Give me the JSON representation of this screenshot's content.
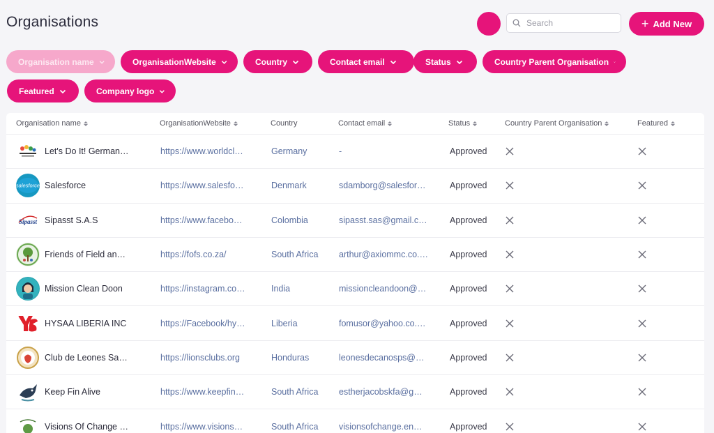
{
  "header": {
    "title": "Organisations",
    "search_placeholder": "Search",
    "add_label": "Add New"
  },
  "filters": [
    {
      "label": "Organisation name",
      "active": false
    },
    {
      "label": "OrganisationWebsite",
      "active": true
    },
    {
      "label": "Country",
      "active": true
    },
    {
      "label": "Contact email",
      "active": true
    },
    {
      "label": "Status",
      "active": true
    },
    {
      "label": "Country Parent Organisation",
      "active": true
    },
    {
      "label": "Featured",
      "active": true
    },
    {
      "label": "Company logo",
      "active": true
    }
  ],
  "columns": [
    "Organisation name",
    "OrganisationWebsite",
    "Country",
    "Contact email",
    "Status",
    "Country Parent Organisation",
    "Featured"
  ],
  "rows": [
    {
      "name": "Let's Do It! German…",
      "website": "https://www.worldcl…",
      "country": "Germany",
      "email": "-",
      "status": "Approved",
      "logo": "letsdoit-germany-logo"
    },
    {
      "name": "Salesforce",
      "website": "https://www.salesfo…",
      "country": "Denmark",
      "email": "sdamborg@salesfor…",
      "status": "Approved",
      "logo": "salesforce-logo"
    },
    {
      "name": "Sipasst S.A.S",
      "website": "https://www.facebo…",
      "country": "Colombia",
      "email": "sipasst.sas@gmail.c…",
      "status": "Approved",
      "logo": "sipasst-logo"
    },
    {
      "name": "Friends of Field an…",
      "website": "https://fofs.co.za/",
      "country": "South Africa",
      "email": "arthur@axiommc.co.…",
      "status": "Approved",
      "logo": "fofs-logo"
    },
    {
      "name": "Mission Clean Doon",
      "website": "https://instagram.co…",
      "country": "India",
      "email": "missioncleandoon@…",
      "status": "Approved",
      "logo": "mission-clean-doon-logo"
    },
    {
      "name": "HYSAA LIBERIA INC",
      "website": "https://Facebook/hy…",
      "country": "Liberia",
      "email": "fomusor@yahoo.co.…",
      "status": "Approved",
      "logo": "hysaa-logo"
    },
    {
      "name": "Club de Leones Sa…",
      "website": "https://lionsclubs.org",
      "country": "Honduras",
      "email": "leonesdecanosps@…",
      "status": "Approved",
      "logo": "lions-club-logo"
    },
    {
      "name": "Keep Fin Alive",
      "website": "https://www.keepfin…",
      "country": "South Africa",
      "email": "estherjacobskfa@g…",
      "status": "Approved",
      "logo": "keep-fin-alive-logo"
    },
    {
      "name": "Visions Of Change …",
      "website": "https://www.visions…",
      "country": "South Africa",
      "email": "visionsofchange.en…",
      "status": "Approved",
      "logo": "visions-of-change-logo"
    }
  ],
  "logo_text": {
    "salesforce": "salesforce",
    "sipasst": "Sipasst",
    "letsdoit": "Let's Do It! Germany"
  },
  "colors": {
    "accent": "#e6147a",
    "accent_inactive": "#f6a8cb",
    "link": "#5a6fa0"
  }
}
